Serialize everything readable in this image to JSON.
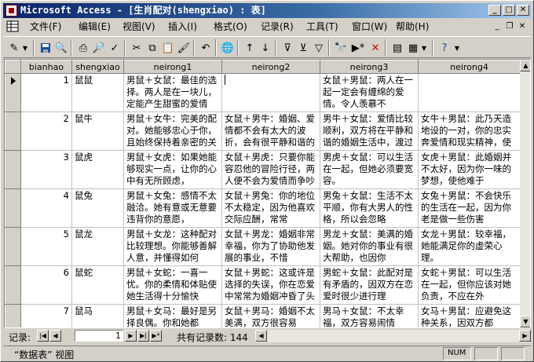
{
  "window": {
    "title": "Microsoft Access - [生肖配对(shengxiao) : 表]"
  },
  "menu": {
    "items": [
      "文件(F)",
      "编辑(E)",
      "视图(V)",
      "插入(I)",
      "格式(O)",
      "记录(R)",
      "工具(T)",
      "窗口(W)",
      "帮助(H)"
    ]
  },
  "table": {
    "columns": [
      "bianhao",
      "shengxiao",
      "neirong1",
      "neirong2",
      "neirong3",
      "neirong4"
    ],
    "rows": [
      {
        "bianhao": "1",
        "shengxiao": "鼠鼠",
        "neirong1": "男鼠＋女鼠：最佳的选择。两人是在一块儿，定能产生甜蜜的爱情",
        "neirong2": "",
        "neirong3": "女鼠＋男鼠：两人在一起一定会有缠绵的爱情。令人羡慕不",
        "neirong4": ""
      },
      {
        "bianhao": "2",
        "shengxiao": "鼠牛",
        "neirong1": "男鼠＋女牛：完美的配对。她能够忠心于你，且始终保持着亲密的关系",
        "neirong2": "女鼠＋男牛：婚姻、爱情都不会有太大的波折，会有很平静和谐的生活",
        "neirong3": "男牛＋女鼠：爱情比较顺利，双方将在平静和谐的婚姻生活中，渡过美满的",
        "neirong4": "女牛＋男鼠：此乃天造地设的一对，你的忠实奔爱情和现实精神，使双方"
      },
      {
        "bianhao": "3",
        "shengxiao": "鼠虎",
        "neirong1": "男鼠＋女虎：如果她能够现实一点，让你的心中有无所顾虑，",
        "neirong2": "女鼠＋男虎：只要你能容忍他的冒险行径，两人便不会为爱情而争吵",
        "neirong3": "男虎＋女鼠：可以生活在一起，但她必须要宽容。",
        "neirong4": "女虎＋男鼠：此婚姻并不太好，因为你一味的梦想，使他难于"
      },
      {
        "bianhao": "4",
        "shengxiao": "鼠兔",
        "neirong1": "男鼠＋女兔：感情不太融洽。她有意或无意要违背你的意愿，",
        "neirong2": "女鼠＋男兔：你的地位不太稳定，因为他喜欢交际应酬，常常",
        "neirong3": "男兔＋女鼠：生活不太平顺，你有大男人的性格，所以会忽略",
        "neirong4": "女兔＋男鼠：不会快乐的生活在一起，因为你老是做一些伤害"
      },
      {
        "bianhao": "5",
        "shengxiao": "鼠龙",
        "neirong1": "男鼠＋女龙：这种配对比较理想。你能够善解人意，并懂得如何",
        "neirong2": "女鼠＋男龙：婚姻非常幸福，你为了协助他发展的事业，不惜",
        "neirong3": "男龙＋女鼠：美满的婚姻。她对你的事业有很大帮助，也因你",
        "neirong4": "女龙＋男鼠：较幸福，她能满足你的虚荣心理。"
      },
      {
        "bianhao": "6",
        "shengxiao": "鼠蛇",
        "neirong1": "男鼠＋女蛇：一喜一忧。你的柔情和体贴使她生活得十分愉快",
        "neirong2": "女鼠＋男蛇：这或许是选择的失误，你在恋爱中常常为婚姻冲昏了头脑",
        "neirong3": "男蛇＋女鼠：此配对是有矛盾的，因双方在恋爱时很少进行理",
        "neirong4": "女蛇＋男鼠：可以生活在一起，但你应该对她负责，不应在外"
      },
      {
        "bianhao": "7",
        "shengxiao": "鼠马",
        "neirong1": "男鼠＋女马：最好是另择良偶。你和她都",
        "neirong2": "女鼠＋男马：婚姻不太美满，双方很容易",
        "neirong3": "男马＋女鼠：不太幸福，双方容易闹情",
        "neirong4": "女马＋男鼠：应避免这种关系，因双方都"
      }
    ]
  },
  "navigation": {
    "label": "记录:",
    "current": "1",
    "total": "共有记录数: 144"
  },
  "status": {
    "view": "“数据表” 视图",
    "num": "NUM"
  },
  "colors": {
    "titlebar": "#0a246a",
    "face": "#d4d0c8"
  }
}
